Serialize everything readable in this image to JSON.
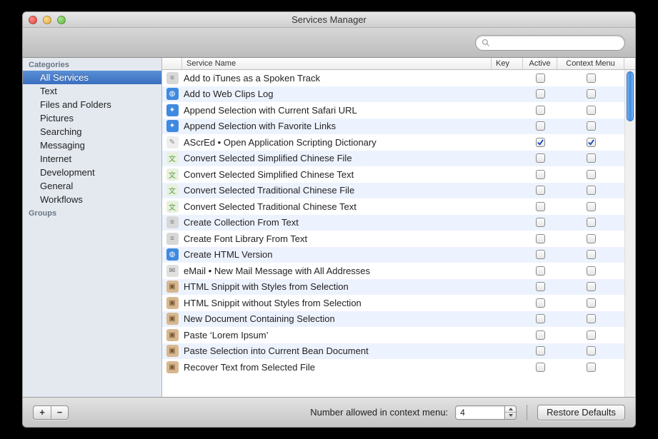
{
  "window": {
    "title": "Services Manager"
  },
  "search": {
    "placeholder": ""
  },
  "sidebar": {
    "sections": [
      {
        "header": "Categories",
        "items": [
          {
            "label": "All Services",
            "selected": true
          },
          {
            "label": "Text"
          },
          {
            "label": "Files and Folders"
          },
          {
            "label": "Pictures"
          },
          {
            "label": "Searching"
          },
          {
            "label": "Messaging"
          },
          {
            "label": "Internet"
          },
          {
            "label": "Development"
          },
          {
            "label": "General"
          },
          {
            "label": "Workflows"
          }
        ]
      },
      {
        "header": "Groups",
        "items": []
      }
    ]
  },
  "table": {
    "columns": {
      "name": "Service Name",
      "key": "Key",
      "active": "Active",
      "ctx": "Context Menu"
    },
    "rows": [
      {
        "name": "Add to iTunes as a Spoken Track",
        "active": false,
        "ctx": false,
        "icon": "doc-gray"
      },
      {
        "name": "Add to Web Clips Log",
        "active": false,
        "ctx": false,
        "icon": "globe-blue"
      },
      {
        "name": "Append Selection with Current Safari URL",
        "active": false,
        "ctx": false,
        "icon": "safari"
      },
      {
        "name": "Append Selection with Favorite Links",
        "active": false,
        "ctx": false,
        "icon": "safari"
      },
      {
        "name": "AScrEd • Open Application Scripting Dictionary",
        "active": true,
        "ctx": true,
        "icon": "script"
      },
      {
        "name": "Convert Selected Simplified Chinese File",
        "active": false,
        "ctx": false,
        "icon": "doc-green"
      },
      {
        "name": "Convert Selected Simplified Chinese Text",
        "active": false,
        "ctx": false,
        "icon": "doc-green"
      },
      {
        "name": "Convert Selected Traditional Chinese File",
        "active": false,
        "ctx": false,
        "icon": "doc-green"
      },
      {
        "name": "Convert Selected Traditional Chinese Text",
        "active": false,
        "ctx": false,
        "icon": "doc-green"
      },
      {
        "name": "Create Collection From Text",
        "active": false,
        "ctx": false,
        "icon": "doc-gray"
      },
      {
        "name": "Create Font Library From Text",
        "active": false,
        "ctx": false,
        "icon": "doc-gray"
      },
      {
        "name": "Create HTML Version",
        "active": false,
        "ctx": false,
        "icon": "globe-blue"
      },
      {
        "name": "eMail • New Mail Message with All Addresses",
        "active": false,
        "ctx": false,
        "icon": "mail"
      },
      {
        "name": "HTML Snippit with Styles from Selection",
        "active": false,
        "ctx": false,
        "icon": "box"
      },
      {
        "name": "HTML Snippit without Styles from Selection",
        "active": false,
        "ctx": false,
        "icon": "box"
      },
      {
        "name": "New Document Containing Selection",
        "active": false,
        "ctx": false,
        "icon": "box"
      },
      {
        "name": "Paste ‘Lorem Ipsum’",
        "active": false,
        "ctx": false,
        "icon": "box"
      },
      {
        "name": "Paste Selection into Current Bean Document",
        "active": false,
        "ctx": false,
        "icon": "box"
      },
      {
        "name": "Recover Text from Selected File",
        "active": false,
        "ctx": false,
        "icon": "box"
      }
    ]
  },
  "bottom": {
    "add": "+",
    "remove": "−",
    "label": "Number allowed in context menu:",
    "value": "4",
    "restore": "Restore Defaults"
  },
  "icons": {
    "doc-gray": {
      "bg": "#d8d8d8",
      "fg": "#777",
      "glyph": "≡"
    },
    "globe-blue": {
      "bg": "#3f8ae0",
      "fg": "#fff",
      "glyph": "◍"
    },
    "safari": {
      "bg": "#3f8ae0",
      "fg": "#fff",
      "glyph": "✦"
    },
    "script": {
      "bg": "#eeeeee",
      "fg": "#888",
      "glyph": "✎"
    },
    "doc-green": {
      "bg": "#e8f0e0",
      "fg": "#5a9c3e",
      "glyph": "文"
    },
    "mail": {
      "bg": "#e0e0e0",
      "fg": "#666",
      "glyph": "✉"
    },
    "box": {
      "bg": "#d8b890",
      "fg": "#7a5a34",
      "glyph": "▣"
    }
  }
}
